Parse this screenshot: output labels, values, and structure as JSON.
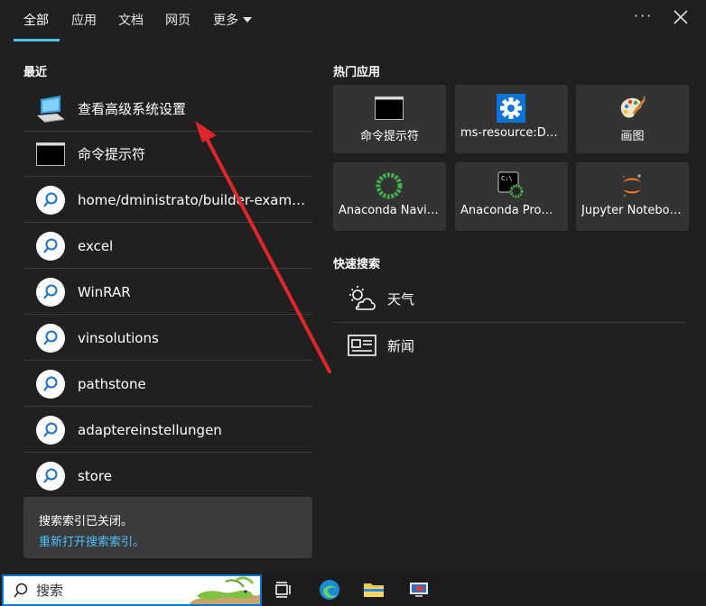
{
  "tabs": [
    {
      "label": "全部",
      "active": true
    },
    {
      "label": "应用"
    },
    {
      "label": "文档"
    },
    {
      "label": "网页"
    },
    {
      "label": "更多"
    }
  ],
  "recent": {
    "title": "最近",
    "items": [
      {
        "label": "查看高级系统设置",
        "icon": "system-settings-icon"
      },
      {
        "label": "命令提示符",
        "icon": "cmd-icon"
      },
      {
        "label": "home/dministrato/builder-example-node",
        "icon": "search-icon"
      },
      {
        "label": "excel",
        "icon": "search-icon"
      },
      {
        "label": "WinRAR",
        "icon": "search-icon"
      },
      {
        "label": "vinsolutions",
        "icon": "search-icon"
      },
      {
        "label": "pathstone",
        "icon": "search-icon"
      },
      {
        "label": "adaptereinstellungen",
        "icon": "search-icon"
      },
      {
        "label": "store",
        "icon": "search-icon"
      }
    ]
  },
  "notice": {
    "line1": "搜索索引已关闭。",
    "link": "重新打开搜索索引。"
  },
  "hot_apps": {
    "title": "热门应用",
    "items": [
      {
        "label": "命令提示符",
        "icon": "cmd-icon"
      },
      {
        "label": "ms-resource:DeviceSettings",
        "icon": "gear-icon"
      },
      {
        "label": "画图",
        "icon": "paint-icon"
      },
      {
        "label": "Anaconda Navigator",
        "icon": "anaconda-icon"
      },
      {
        "label": "Anaconda Prompt",
        "icon": "anaconda-prompt-icon"
      },
      {
        "label": "Jupyter Notebook",
        "icon": "jupyter-icon"
      }
    ]
  },
  "quick_search": {
    "title": "快速搜索",
    "items": [
      {
        "label": "天气",
        "icon": "weather-icon"
      },
      {
        "label": "新闻",
        "icon": "news-icon"
      }
    ]
  },
  "taskbar": {
    "search_placeholder": "搜索"
  },
  "colors": {
    "accent": "#4cc2ff",
    "background": "#202020",
    "tile": "#333333",
    "annotation_arrow": "#e0262b"
  }
}
